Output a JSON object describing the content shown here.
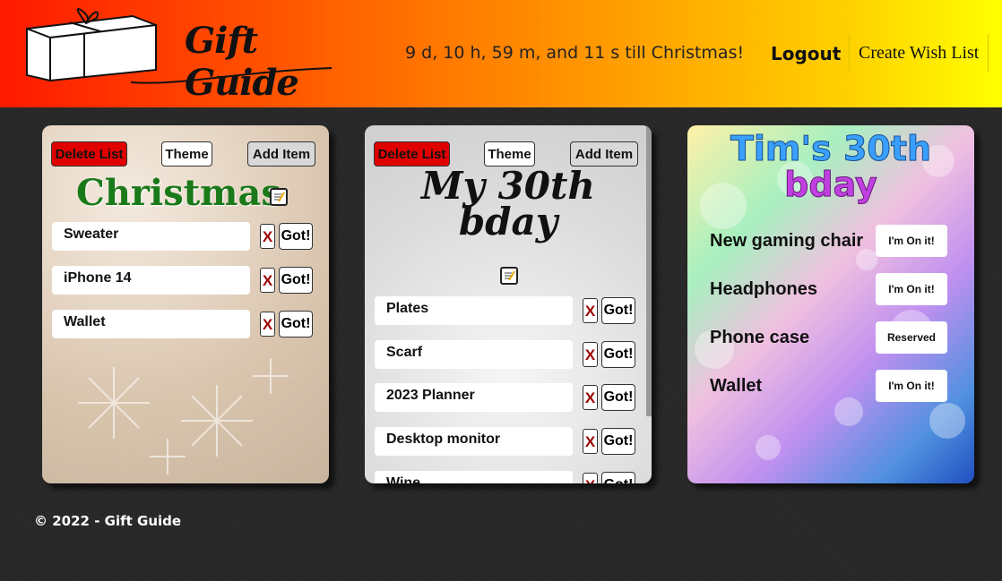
{
  "header": {
    "logo_text": "Gift Guide",
    "countdown": "9 d, 10 h, 59 m, and 11 s till Christmas!",
    "logout": "Logout",
    "create": "Create Wish List"
  },
  "buttons": {
    "delete": "Delete List",
    "theme": "Theme",
    "add": "Add Item",
    "x": "X",
    "got": "Got!"
  },
  "card1": {
    "title": "Christmas",
    "items": [
      "Sweater",
      "iPhone 14",
      "Wallet"
    ]
  },
  "card2": {
    "title_line1": "My 30th",
    "title_line2": "bday",
    "items": [
      "Plates",
      "Scarf",
      "2023 Planner",
      "Desktop monitor",
      "Wine"
    ]
  },
  "card3": {
    "title_line1": "Tim's 30th",
    "title_line2": "bday",
    "items": [
      {
        "name": "New gaming chair",
        "status": "I'm On it!"
      },
      {
        "name": "Headphones",
        "status": "I'm On it!"
      },
      {
        "name": "Phone case",
        "status": "Reserved"
      },
      {
        "name": "Wallet",
        "status": "I'm On it!"
      }
    ]
  },
  "footer": "© 2022 - Gift Guide",
  "colors": {
    "header_start": "#ff1a00",
    "header_end": "#ffff00",
    "delete": "#e00000",
    "christmas_title": "#1a7a1a"
  }
}
